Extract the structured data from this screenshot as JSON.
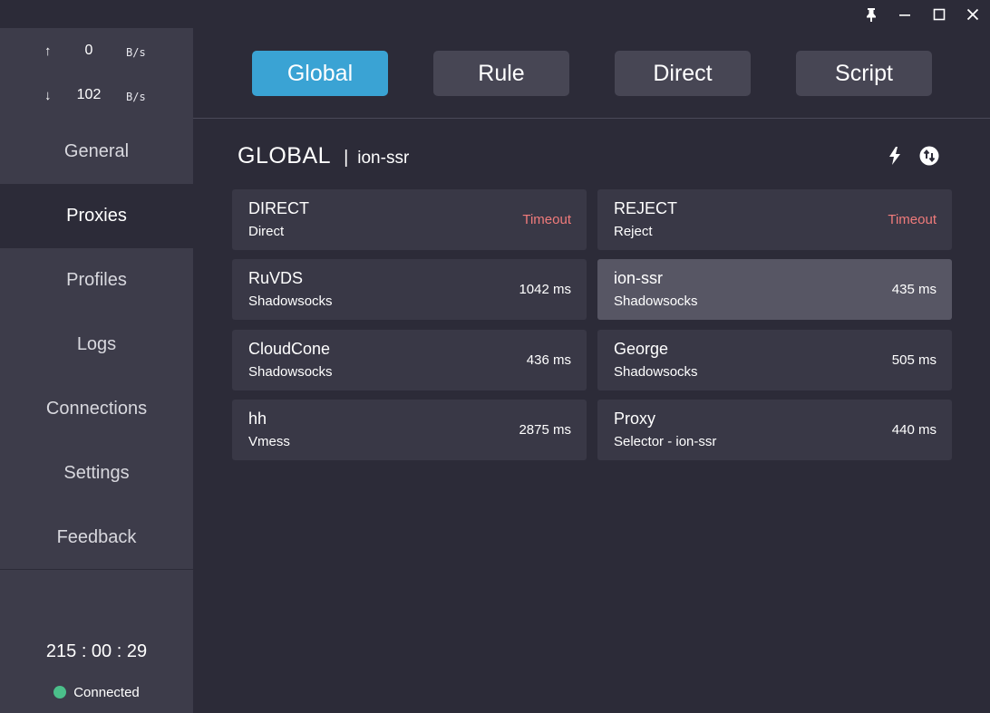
{
  "window": {
    "buttons": [
      "pin",
      "minimize",
      "maximize",
      "close"
    ]
  },
  "traffic": {
    "upload": {
      "arrow": "↑",
      "value": "0",
      "unit": "B/s"
    },
    "download": {
      "arrow": "↓",
      "value": "102",
      "unit": "B/s"
    }
  },
  "sidebar": {
    "items": [
      {
        "label": "General"
      },
      {
        "label": "Proxies"
      },
      {
        "label": "Profiles"
      },
      {
        "label": "Logs"
      },
      {
        "label": "Connections"
      },
      {
        "label": "Settings"
      },
      {
        "label": "Feedback"
      }
    ],
    "active": "Proxies",
    "timer": "215 : 00 : 29",
    "status": "Connected",
    "status_color": "#4bbf8a"
  },
  "modes": {
    "items": [
      {
        "label": "Global"
      },
      {
        "label": "Rule"
      },
      {
        "label": "Direct"
      },
      {
        "label": "Script"
      }
    ],
    "active": "Global",
    "accent": "#3aa3d4"
  },
  "group": {
    "name": "GLOBAL",
    "separator": "|",
    "selected": "ion-ssr",
    "icons": [
      "lightning-icon",
      "refresh-icon"
    ]
  },
  "proxies": [
    {
      "name": "DIRECT",
      "type": "Direct",
      "delay": "Timeout",
      "timeout": true
    },
    {
      "name": "REJECT",
      "type": "Reject",
      "delay": "Timeout",
      "timeout": true
    },
    {
      "name": "RuVDS",
      "type": "Shadowsocks",
      "delay": "1042 ms"
    },
    {
      "name": "ion-ssr",
      "type": "Shadowsocks",
      "delay": "435 ms",
      "selected": true
    },
    {
      "name": "CloudCone",
      "type": "Shadowsocks",
      "delay": "436 ms"
    },
    {
      "name": "George",
      "type": "Shadowsocks",
      "delay": "505 ms"
    },
    {
      "name": "hh",
      "type": "Vmess",
      "delay": "2875 ms"
    },
    {
      "name": "Proxy",
      "type": "Selector - ion-ssr",
      "delay": "440 ms"
    }
  ],
  "colors": {
    "background": "#2c2b38",
    "sidebar": "#3d3c4a",
    "timeout": "#f07b7b"
  }
}
